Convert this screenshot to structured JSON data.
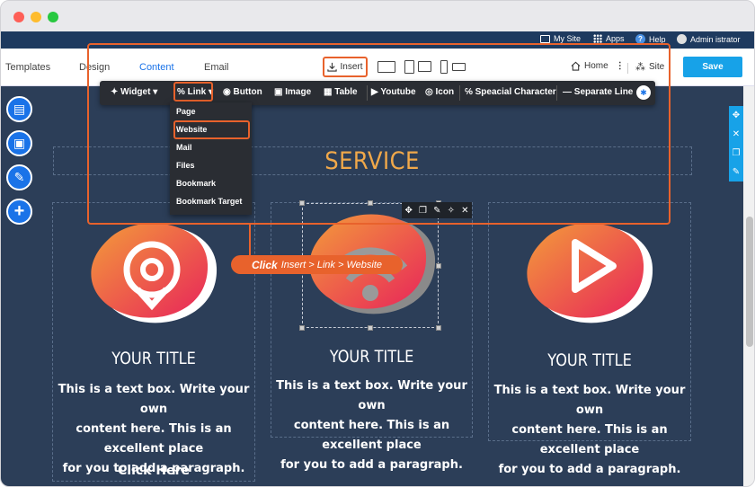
{
  "window": {
    "controls": [
      "close",
      "minimize",
      "maximize"
    ]
  },
  "topbar": {
    "my_site": "My Site",
    "apps": "Apps",
    "help": "Help",
    "user": "Admin istrator"
  },
  "nav": {
    "tabs": [
      "Templates",
      "Design",
      "Content",
      "Email"
    ],
    "active_tab": "Content",
    "insert": "Insert",
    "home": "Home",
    "site": "Site",
    "save": "Save"
  },
  "toolbar": {
    "widget": "Widget",
    "link": "Link",
    "button": "Button",
    "image": "Image",
    "table": "Table",
    "youtube": "Youtube",
    "icon": "Icon",
    "special_character": "Speacial Character",
    "separate_line": "Separate Line"
  },
  "link_menu": {
    "items": [
      "Page",
      "Website",
      "Mail",
      "Files",
      "Bookmark",
      "Bookmark Target"
    ],
    "highlighted": "Website"
  },
  "callout": {
    "action": "Click",
    "path": "Insert > Link > Website"
  },
  "content": {
    "section_title": "SERVICE",
    "columns": [
      {
        "icon": "location-pin-icon",
        "title": "YOUR TITLE",
        "text": [
          "This is a text box. Write your own",
          "content here. This is an excellent place",
          "for you to add a paragraph."
        ],
        "link": "Click Here"
      },
      {
        "icon": "wifi-icon",
        "title": "YOUR TITLE",
        "text": [
          "This is a text box. Write your own",
          "content here. This is an excellent place",
          "for you to add a paragraph."
        ]
      },
      {
        "icon": "play-icon",
        "title": "YOUR TITLE",
        "text": [
          "This is a text box. Write your own",
          "content here. This is an excellent place",
          "for you to add a paragraph."
        ]
      }
    ]
  },
  "colors": {
    "accent": "#e8622c",
    "brand_blue": "#1a73e8",
    "save": "#17a2e8",
    "section_title": "#f0a84a",
    "canvas_bg": "#2c3e58",
    "toolbar_bg": "#2a2d33"
  }
}
